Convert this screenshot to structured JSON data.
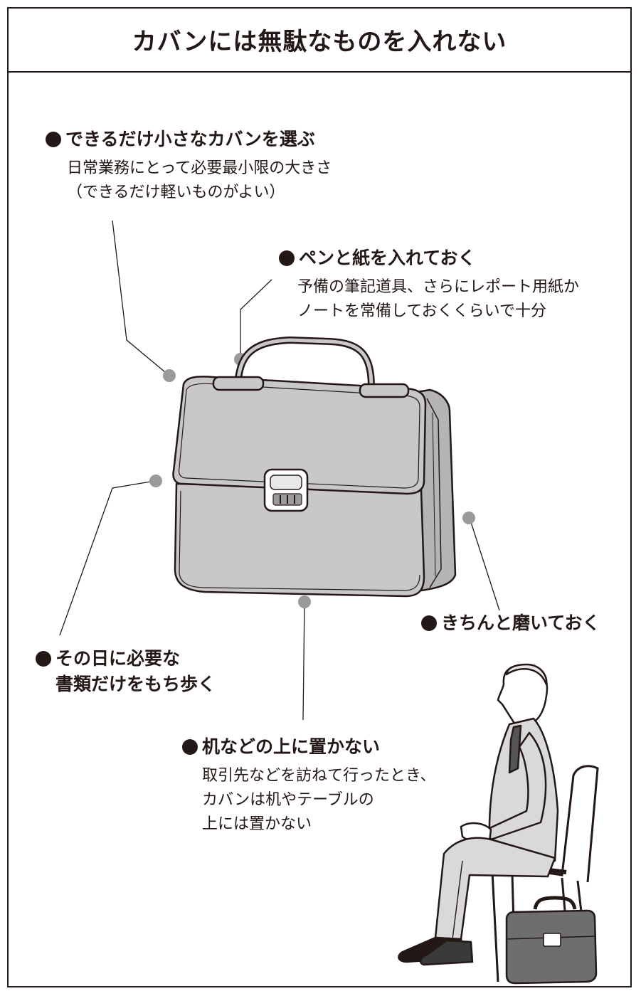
{
  "title": "カバンには無駄なものを入れない",
  "colors": {
    "ink": "#231815",
    "bag_fill": "#c8c8c8",
    "suit_fill": "#d9d9d9",
    "leader_dot": "#9a9a9a"
  },
  "tips": [
    {
      "id": "small-bag",
      "heading": "できるだけ小さなカバンを選ぶ",
      "description": "日常業務にとって必要最小限の大きさ\n（できるだけ軽いものがよい）"
    },
    {
      "id": "pen-paper",
      "heading": "ペンと紙を入れておく",
      "description": "予備の筆記道具、さらにレポート用紙か\nノートを常備しておくくらいで十分"
    },
    {
      "id": "polish",
      "heading": "きちんと磨いておく",
      "description": ""
    },
    {
      "id": "documents",
      "heading": "その日に必要な\n書類だけをもち歩く",
      "description": ""
    },
    {
      "id": "not-on-desk",
      "heading": "机などの上に置かない",
      "description": "取引先などを訪ねて行ったとき、\nカバンは机やテーブルの\n上には置かない"
    }
  ],
  "icons": [
    "briefcase-illustration",
    "seated-businessman-illustration",
    "small-briefcase-illustration"
  ]
}
